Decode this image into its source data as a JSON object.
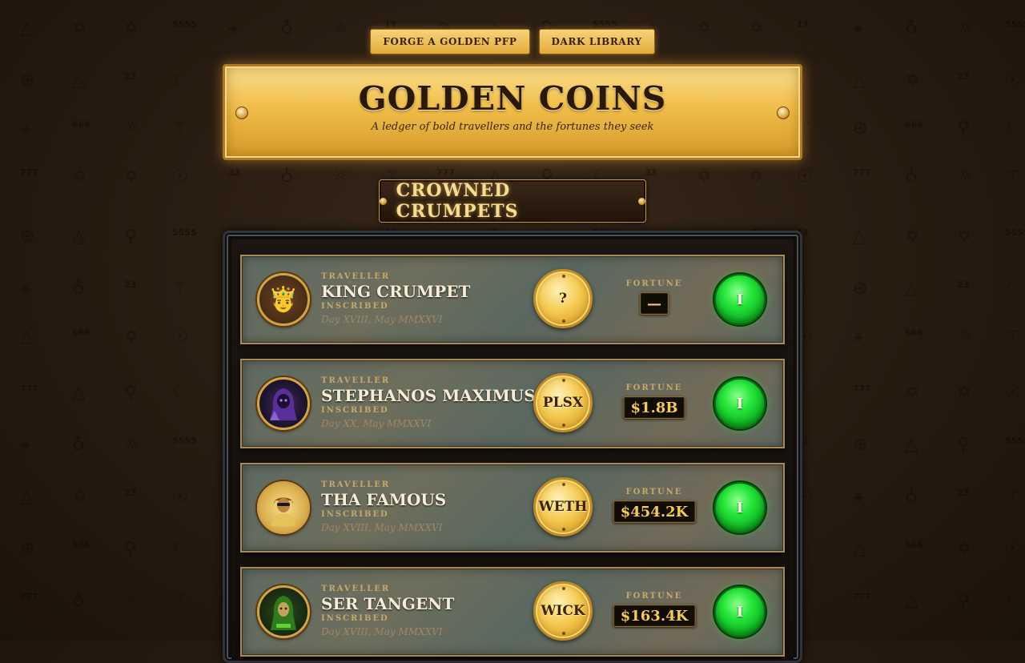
{
  "nav": {
    "forge_label": "FORGE A GOLDEN PFP",
    "library_label": "DARK LIBRARY"
  },
  "header": {
    "title": "GOLDEN COINS",
    "subtitle": "A ledger of bold travellers and the fortunes they seek"
  },
  "section": {
    "title": "CROWNED CRUMPETS"
  },
  "labels": {
    "traveller": "TRAVELLER",
    "inscribed": "INSCRIBED",
    "fortune": "FORTUNE"
  },
  "entries": [
    {
      "name": "KING CRUMPET",
      "date": "Day XVIII, May MMXXVI",
      "coin": "?",
      "fortune": "—",
      "rank": "I",
      "avatar_icon": "crowned-person-icon"
    },
    {
      "name": "STEPHANOS MAXIMUS",
      "date": "Day XX, May MMXXVI",
      "coin": "PLSX",
      "fortune": "$1.8B",
      "rank": "I",
      "avatar_icon": "hooded-figure-icon"
    },
    {
      "name": "THA FAMOUS",
      "date": "Day XVIII, May MMXXVI",
      "coin": "WETH",
      "fortune": "$454.2K",
      "rank": "I",
      "avatar_icon": "golden-portrait-icon"
    },
    {
      "name": "SER TANGENT",
      "date": "Day XVIII, May MMXXVI",
      "coin": "WICK",
      "fortune": "$163.4K",
      "rank": "I",
      "avatar_icon": "green-cloaked-figure-icon"
    }
  ],
  "colors": {
    "gold": "#f0bd4a",
    "dark_brown": "#2a1d12",
    "rank_green": "#25e63a"
  }
}
